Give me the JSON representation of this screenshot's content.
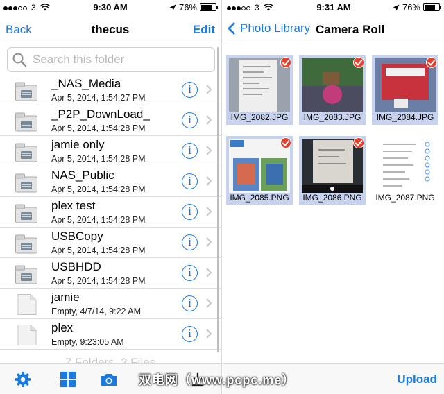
{
  "left": {
    "status": {
      "carrier": "3",
      "time": "9:30 AM",
      "battery": "76%",
      "battery_level": 0.76
    },
    "nav": {
      "back": "Back",
      "title": "thecus",
      "edit": "Edit"
    },
    "search": {
      "placeholder": "Search this folder"
    },
    "files": [
      {
        "name": "_NAS_Media",
        "date": "Apr 5, 2014, 1:54:27 PM",
        "type": "folder"
      },
      {
        "name": "_P2P_DownLoad_",
        "date": "Apr 5, 2014, 1:54:28 PM",
        "type": "folder"
      },
      {
        "name": "jamie only",
        "date": "Apr 5, 2014, 1:54:28 PM",
        "type": "folder"
      },
      {
        "name": "NAS_Public",
        "date": "Apr 5, 2014, 1:54:28 PM",
        "type": "folder"
      },
      {
        "name": "plex test",
        "date": "Apr 5, 2014, 1:54:28 PM",
        "type": "folder"
      },
      {
        "name": "USBCopy",
        "date": "Apr 5, 2014, 1:54:28 PM",
        "type": "folder"
      },
      {
        "name": "USBHDD",
        "date": "Apr 5, 2014, 1:54:28 PM",
        "type": "folder"
      },
      {
        "name": "jamie",
        "date": "Empty, 4/7/14, 9:22 AM",
        "type": "file"
      },
      {
        "name": "plex",
        "date": "Empty, 9:23:05 AM",
        "type": "file"
      }
    ],
    "info_glyph": "i",
    "footer": "7 Folders, 2 Files",
    "toolbar": [
      "gear-icon",
      "grid-icon",
      "camera-icon",
      "download-icon"
    ]
  },
  "right": {
    "status": {
      "carrier": "3",
      "time": "9:31 AM",
      "battery": "76%",
      "battery_level": 0.76
    },
    "nav": {
      "back": "Photo Library",
      "title": "Camera Roll"
    },
    "photos": [
      {
        "label": "IMG_2082.JPG",
        "selected": true
      },
      {
        "label": "IMG_2083.JPG",
        "selected": true
      },
      {
        "label": "IMG_2084.JPG",
        "selected": true
      },
      {
        "label": "IMG_2085.PNG",
        "selected": true
      },
      {
        "label": "IMG_2086.PNG",
        "selected": true
      },
      {
        "label": "IMG_2087.PNG",
        "selected": false
      }
    ],
    "upload": "Upload"
  },
  "watermark": "双电网（www.pcpc.me）",
  "colors": {
    "accent": "#1a7ae0",
    "selection": "#c7d2ee",
    "check": "#e3422f"
  }
}
